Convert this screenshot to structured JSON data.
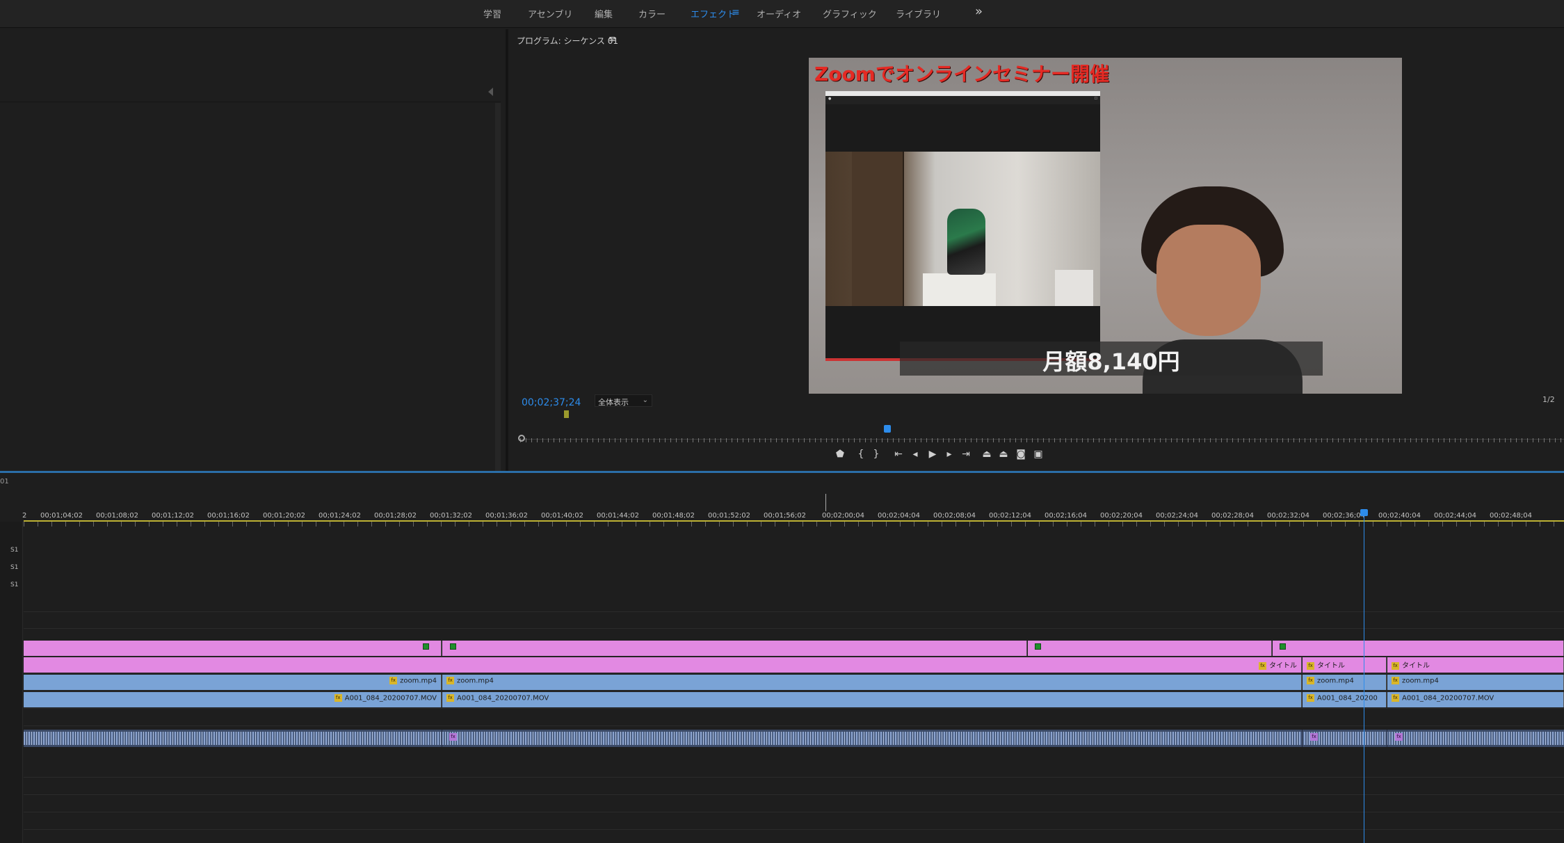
{
  "workspaces": [
    {
      "label": "学習",
      "active": false
    },
    {
      "label": "アセンブリ",
      "active": false
    },
    {
      "label": "編集",
      "active": false
    },
    {
      "label": "カラー",
      "active": false
    },
    {
      "label": "エフェクト",
      "active": true
    },
    {
      "label": "オーディオ",
      "active": false
    },
    {
      "label": "グラフィック",
      "active": false
    },
    {
      "label": "ライブラリ",
      "active": false
    }
  ],
  "workspace_menu_icon": "≡",
  "workspace_more_icon": "»",
  "monitor": {
    "title": "プログラム: シーケンス 01",
    "menu_icon": "≡",
    "video_title": "Zoomでオンラインセミナー開催",
    "price_caption": "月額8,140円",
    "timecode": "00;02;37;24",
    "fit": "全体表示",
    "resolution": "1/2",
    "playhead_progress": 0.352
  },
  "transport": [
    "marker-icon",
    "mark-in-icon",
    "mark-out-icon",
    "go-to-in-icon",
    "step-back-icon",
    "play-icon",
    "step-forward-icon",
    "go-to-out-icon",
    "lift-icon",
    "extract-icon",
    "export-frame-icon",
    "compare-icon"
  ],
  "timeline": {
    "sequence_label": "01",
    "ticks": [
      "2",
      "00;01;04;02",
      "00;01;08;02",
      "00;01;12;02",
      "00;01;16;02",
      "00;01;20;02",
      "00;01;24;02",
      "00;01;28;02",
      "00;01;32;02",
      "00;01;36;02",
      "00;01;40;02",
      "00;01;44;02",
      "00;01;48;02",
      "00;01;52;02",
      "00;01;56;02",
      "00;02;00;04",
      "00;02;04;04",
      "00;02;08;04",
      "00;02;12;04",
      "00;02;16;04",
      "00;02;20;04",
      "00;02;24;04",
      "00;02;28;04",
      "00;02;32;04",
      "00;02;36;04",
      "00;02;40;04",
      "00;02;44;04",
      "00;02;48;04"
    ],
    "v4": [],
    "v3": [],
    "v2_titles": [
      "タイトル",
      "タイトル",
      "タイトル"
    ],
    "v1_clips": [
      "zoom.mp4",
      "zoom.mp4",
      "zoom.mp4",
      "zoom.mp4"
    ],
    "a_clips": [
      "A001_084_20200707.MOV",
      "A001_084_20200707.MOV",
      "A001_084_20200",
      "A001_084_20200707.MOV"
    ],
    "track_labels": [
      "S1",
      "S1",
      "S1"
    ],
    "fx_badge": "fx"
  }
}
